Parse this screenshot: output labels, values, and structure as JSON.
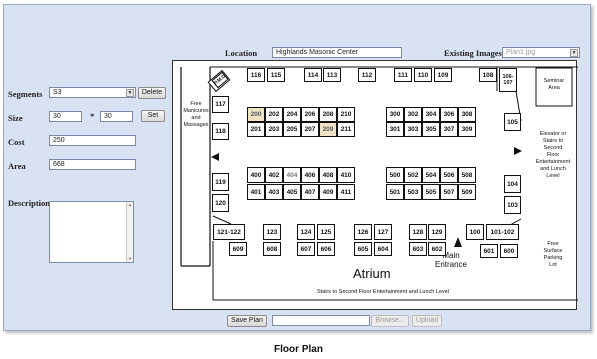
{
  "form": {
    "location_label": "Location",
    "location_value": "Highlands Masonic Center",
    "existing_images_label": "Existing Images",
    "existing_images_value": "Plan1.jpg",
    "segments_label": "Segments",
    "segments_value": "S3",
    "delete_label": "Delete",
    "size_label": "Size",
    "size_w": "30",
    "size_sep": "*",
    "size_h": "30",
    "set_label": "Set",
    "cost_label": "Cost",
    "cost_value": "250",
    "area_label": "Area",
    "area_value": "668",
    "description_label": "Description",
    "description_value": ""
  },
  "bottom": {
    "save_plan": "Save Plan",
    "browse": "Browse...",
    "upload": "Upload"
  },
  "caption": "Floor Plan",
  "plan": {
    "atrium": "Atrium",
    "main_entrance_1": "Main",
    "main_entrance_2": "Entrance",
    "stairs_bottom": "Stairs to Second Floor Entertainment and Lunch Level",
    "free_manicures": [
      "Free",
      "Manicures",
      "and",
      "Massages"
    ],
    "seminar": [
      "Seminar",
      "Area"
    ],
    "elevator": [
      "Elevator or",
      "Stairs to",
      "Second",
      "Floor",
      "Entertainment",
      "and Lunch",
      "Level"
    ],
    "parking": [
      "Free",
      "Surface",
      "Parking",
      "Lot"
    ],
    "booths": {
      "b116": "116",
      "b115": "115",
      "b114": "114",
      "b113": "113",
      "b112": "112",
      "b111": "111",
      "b110": "110",
      "b109": "109",
      "b108": "108",
      "b106": "106-107",
      "b117": "117",
      "b118": "118",
      "b200": "200",
      "b202": "202",
      "b204": "204",
      "b206": "206",
      "b208": "208",
      "b210": "210",
      "b201": "201",
      "b203": "203",
      "b205": "205",
      "b207": "207",
      "b209": "209",
      "b211": "211",
      "b300": "300",
      "b302": "302",
      "b304": "304",
      "b306": "306",
      "b308": "308",
      "b301": "301",
      "b303": "303",
      "b305": "305",
      "b307": "307",
      "b309": "309",
      "b105": "105",
      "b119": "119",
      "b120": "120",
      "b400": "400",
      "b402": "402",
      "b404": "404",
      "b406": "406",
      "b408": "408",
      "b410": "410",
      "b401": "401",
      "b403": "403",
      "b405": "405",
      "b407": "407",
      "b409": "409",
      "b411": "411",
      "b500": "500",
      "b502": "502",
      "b504": "504",
      "b506": "506",
      "b508": "508",
      "b501": "501",
      "b503": "503",
      "b505": "505",
      "b507": "507",
      "b509": "509",
      "b104": "104",
      "b103": "103",
      "b121": "121-122",
      "b123": "123",
      "b124": "124",
      "b125": "125",
      "b126": "126",
      "b127": "127",
      "b128": "128",
      "b129": "129",
      "b100": "100",
      "b101": "101-102",
      "b609": "609",
      "b608": "608",
      "b607": "607",
      "b606": "606",
      "b605": "605",
      "b604": "604",
      "b603": "603",
      "b602": "602",
      "b601": "601",
      "b600": "600"
    }
  }
}
